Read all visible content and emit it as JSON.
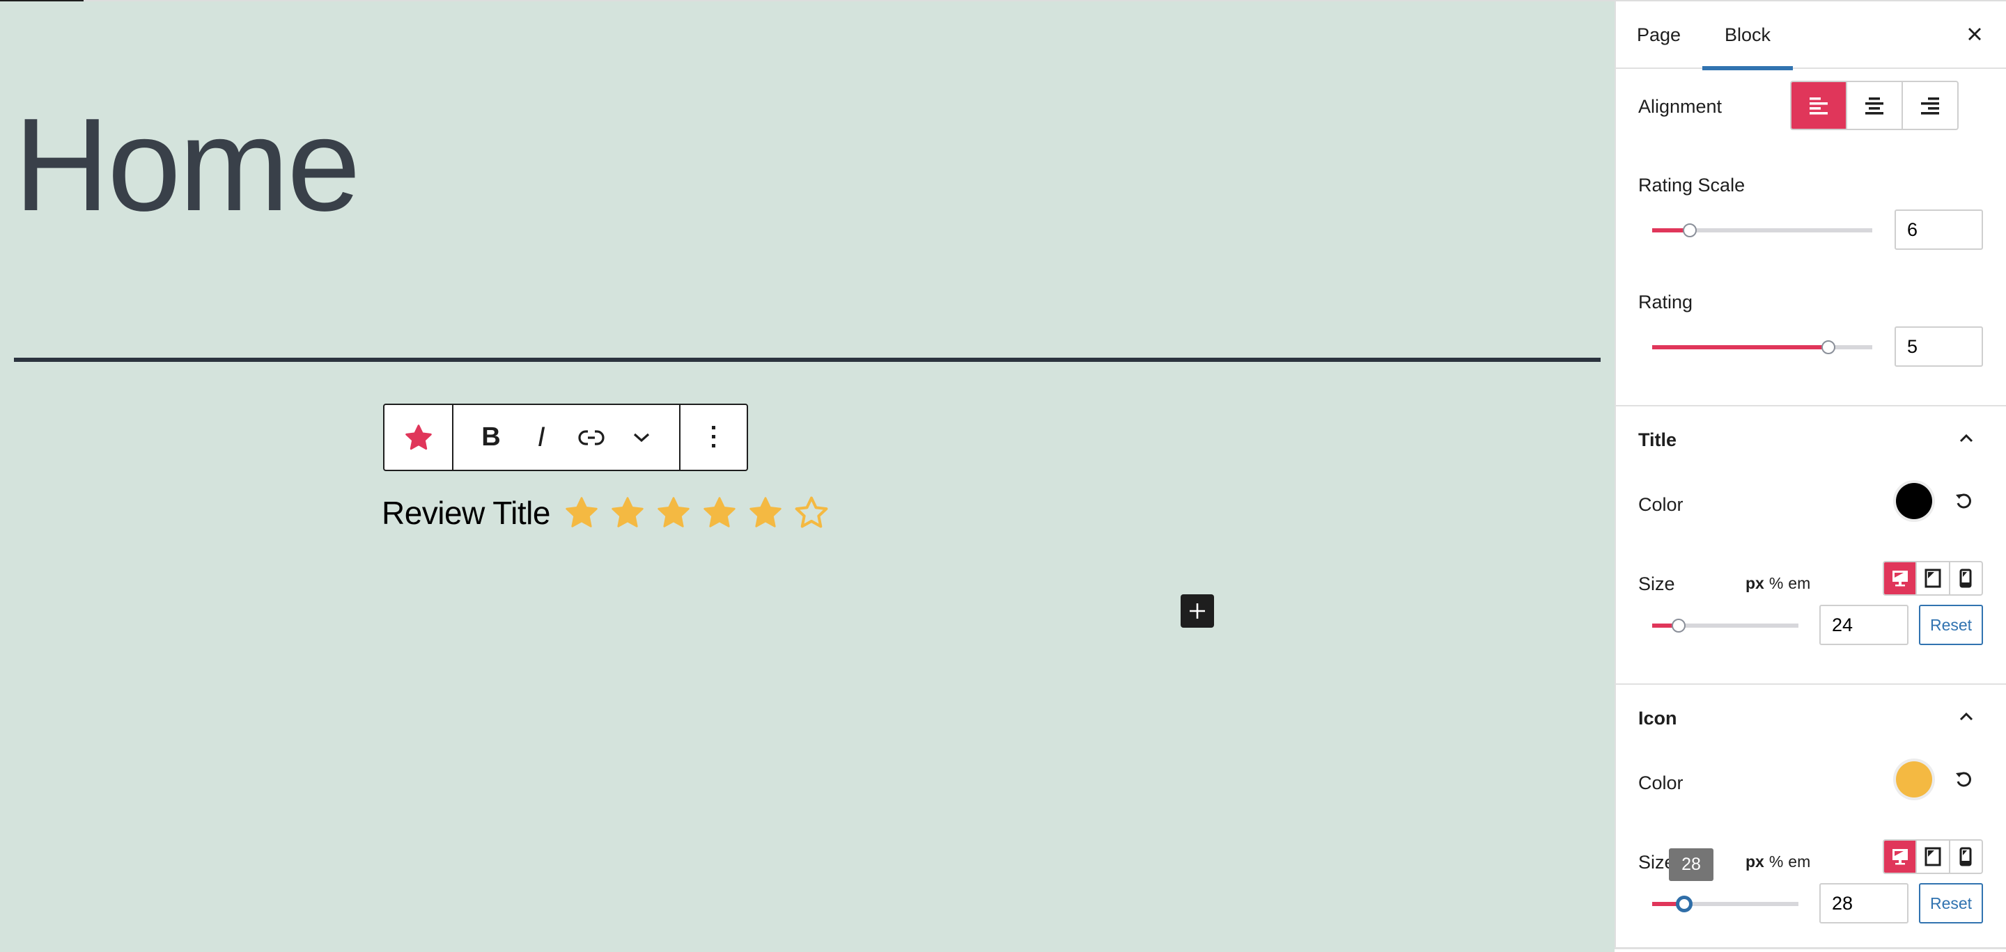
{
  "canvas": {
    "background_color": "#d4e3dc",
    "page_title": "Home",
    "block_toolbar": {
      "block_type_icon": "star-icon",
      "bold_label": "B",
      "italic_label": "I",
      "link_icon": "link-icon",
      "more_formats_icon": "chevron-down-icon",
      "options_icon": "more-vertical-icon"
    },
    "review": {
      "title": "Review Title",
      "rating": 5,
      "scale": 6,
      "star_color": "#f4b942"
    },
    "inserter_icon": "plus-icon"
  },
  "sidebar": {
    "tabs": [
      {
        "label": "Page",
        "active": false
      },
      {
        "label": "Block",
        "active": true
      }
    ],
    "close_icon": "close-icon",
    "alignment": {
      "label": "Alignment",
      "options": [
        "align-left",
        "align-center",
        "align-right"
      ],
      "selected": "align-left"
    },
    "rating_scale": {
      "label": "Rating Scale",
      "value": "6",
      "slider_fraction": 0.17
    },
    "rating": {
      "label": "Rating",
      "value": "5",
      "slider_fraction": 0.8
    },
    "title_panel": {
      "heading": "Title",
      "expanded": true,
      "color_label": "Color",
      "color_value": "#000000",
      "size_label": "Size",
      "units": [
        "px",
        "%",
        "em"
      ],
      "selected_unit": "px",
      "devices": [
        "desktop",
        "tablet",
        "mobile"
      ],
      "selected_device": "desktop",
      "size_value": "24",
      "slider_fraction": 0.18,
      "reset_label": "Reset"
    },
    "icon_panel": {
      "heading": "Icon",
      "expanded": true,
      "color_label": "Color",
      "color_value": "#f4b942",
      "size_label": "Size",
      "units": [
        "px",
        "%",
        "em"
      ],
      "selected_unit": "px",
      "devices": [
        "desktop",
        "tablet",
        "mobile"
      ],
      "selected_device": "desktop",
      "size_value": "28",
      "slider_fraction": 0.22,
      "tooltip": "28",
      "reset_label": "Reset"
    }
  },
  "colors": {
    "accent": "#e0365a",
    "tab_indicator": "#3173b0"
  }
}
